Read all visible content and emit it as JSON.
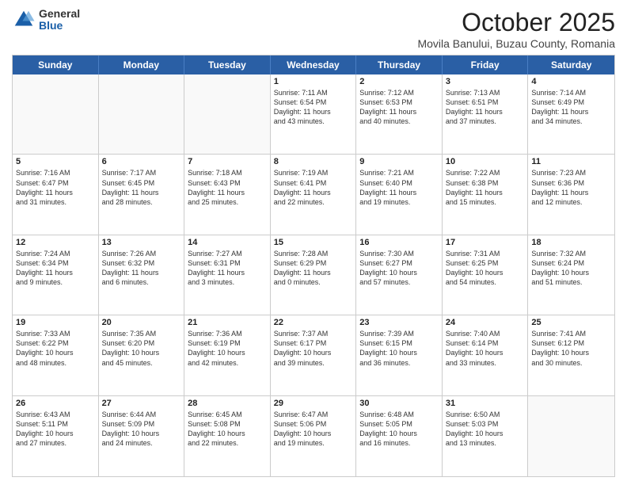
{
  "logo": {
    "general": "General",
    "blue": "Blue"
  },
  "header": {
    "month": "October 2025",
    "location": "Movila Banului, Buzau County, Romania"
  },
  "days": [
    "Sunday",
    "Monday",
    "Tuesday",
    "Wednesday",
    "Thursday",
    "Friday",
    "Saturday"
  ],
  "weeks": [
    [
      {
        "day": "",
        "info": ""
      },
      {
        "day": "",
        "info": ""
      },
      {
        "day": "",
        "info": ""
      },
      {
        "day": "1",
        "info": "Sunrise: 7:11 AM\nSunset: 6:54 PM\nDaylight: 11 hours\nand 43 minutes."
      },
      {
        "day": "2",
        "info": "Sunrise: 7:12 AM\nSunset: 6:53 PM\nDaylight: 11 hours\nand 40 minutes."
      },
      {
        "day": "3",
        "info": "Sunrise: 7:13 AM\nSunset: 6:51 PM\nDaylight: 11 hours\nand 37 minutes."
      },
      {
        "day": "4",
        "info": "Sunrise: 7:14 AM\nSunset: 6:49 PM\nDaylight: 11 hours\nand 34 minutes."
      }
    ],
    [
      {
        "day": "5",
        "info": "Sunrise: 7:16 AM\nSunset: 6:47 PM\nDaylight: 11 hours\nand 31 minutes."
      },
      {
        "day": "6",
        "info": "Sunrise: 7:17 AM\nSunset: 6:45 PM\nDaylight: 11 hours\nand 28 minutes."
      },
      {
        "day": "7",
        "info": "Sunrise: 7:18 AM\nSunset: 6:43 PM\nDaylight: 11 hours\nand 25 minutes."
      },
      {
        "day": "8",
        "info": "Sunrise: 7:19 AM\nSunset: 6:41 PM\nDaylight: 11 hours\nand 22 minutes."
      },
      {
        "day": "9",
        "info": "Sunrise: 7:21 AM\nSunset: 6:40 PM\nDaylight: 11 hours\nand 19 minutes."
      },
      {
        "day": "10",
        "info": "Sunrise: 7:22 AM\nSunset: 6:38 PM\nDaylight: 11 hours\nand 15 minutes."
      },
      {
        "day": "11",
        "info": "Sunrise: 7:23 AM\nSunset: 6:36 PM\nDaylight: 11 hours\nand 12 minutes."
      }
    ],
    [
      {
        "day": "12",
        "info": "Sunrise: 7:24 AM\nSunset: 6:34 PM\nDaylight: 11 hours\nand 9 minutes."
      },
      {
        "day": "13",
        "info": "Sunrise: 7:26 AM\nSunset: 6:32 PM\nDaylight: 11 hours\nand 6 minutes."
      },
      {
        "day": "14",
        "info": "Sunrise: 7:27 AM\nSunset: 6:31 PM\nDaylight: 11 hours\nand 3 minutes."
      },
      {
        "day": "15",
        "info": "Sunrise: 7:28 AM\nSunset: 6:29 PM\nDaylight: 11 hours\nand 0 minutes."
      },
      {
        "day": "16",
        "info": "Sunrise: 7:30 AM\nSunset: 6:27 PM\nDaylight: 10 hours\nand 57 minutes."
      },
      {
        "day": "17",
        "info": "Sunrise: 7:31 AM\nSunset: 6:25 PM\nDaylight: 10 hours\nand 54 minutes."
      },
      {
        "day": "18",
        "info": "Sunrise: 7:32 AM\nSunset: 6:24 PM\nDaylight: 10 hours\nand 51 minutes."
      }
    ],
    [
      {
        "day": "19",
        "info": "Sunrise: 7:33 AM\nSunset: 6:22 PM\nDaylight: 10 hours\nand 48 minutes."
      },
      {
        "day": "20",
        "info": "Sunrise: 7:35 AM\nSunset: 6:20 PM\nDaylight: 10 hours\nand 45 minutes."
      },
      {
        "day": "21",
        "info": "Sunrise: 7:36 AM\nSunset: 6:19 PM\nDaylight: 10 hours\nand 42 minutes."
      },
      {
        "day": "22",
        "info": "Sunrise: 7:37 AM\nSunset: 6:17 PM\nDaylight: 10 hours\nand 39 minutes."
      },
      {
        "day": "23",
        "info": "Sunrise: 7:39 AM\nSunset: 6:15 PM\nDaylight: 10 hours\nand 36 minutes."
      },
      {
        "day": "24",
        "info": "Sunrise: 7:40 AM\nSunset: 6:14 PM\nDaylight: 10 hours\nand 33 minutes."
      },
      {
        "day": "25",
        "info": "Sunrise: 7:41 AM\nSunset: 6:12 PM\nDaylight: 10 hours\nand 30 minutes."
      }
    ],
    [
      {
        "day": "26",
        "info": "Sunrise: 6:43 AM\nSunset: 5:11 PM\nDaylight: 10 hours\nand 27 minutes."
      },
      {
        "day": "27",
        "info": "Sunrise: 6:44 AM\nSunset: 5:09 PM\nDaylight: 10 hours\nand 24 minutes."
      },
      {
        "day": "28",
        "info": "Sunrise: 6:45 AM\nSunset: 5:08 PM\nDaylight: 10 hours\nand 22 minutes."
      },
      {
        "day": "29",
        "info": "Sunrise: 6:47 AM\nSunset: 5:06 PM\nDaylight: 10 hours\nand 19 minutes."
      },
      {
        "day": "30",
        "info": "Sunrise: 6:48 AM\nSunset: 5:05 PM\nDaylight: 10 hours\nand 16 minutes."
      },
      {
        "day": "31",
        "info": "Sunrise: 6:50 AM\nSunset: 5:03 PM\nDaylight: 10 hours\nand 13 minutes."
      },
      {
        "day": "",
        "info": ""
      }
    ]
  ]
}
